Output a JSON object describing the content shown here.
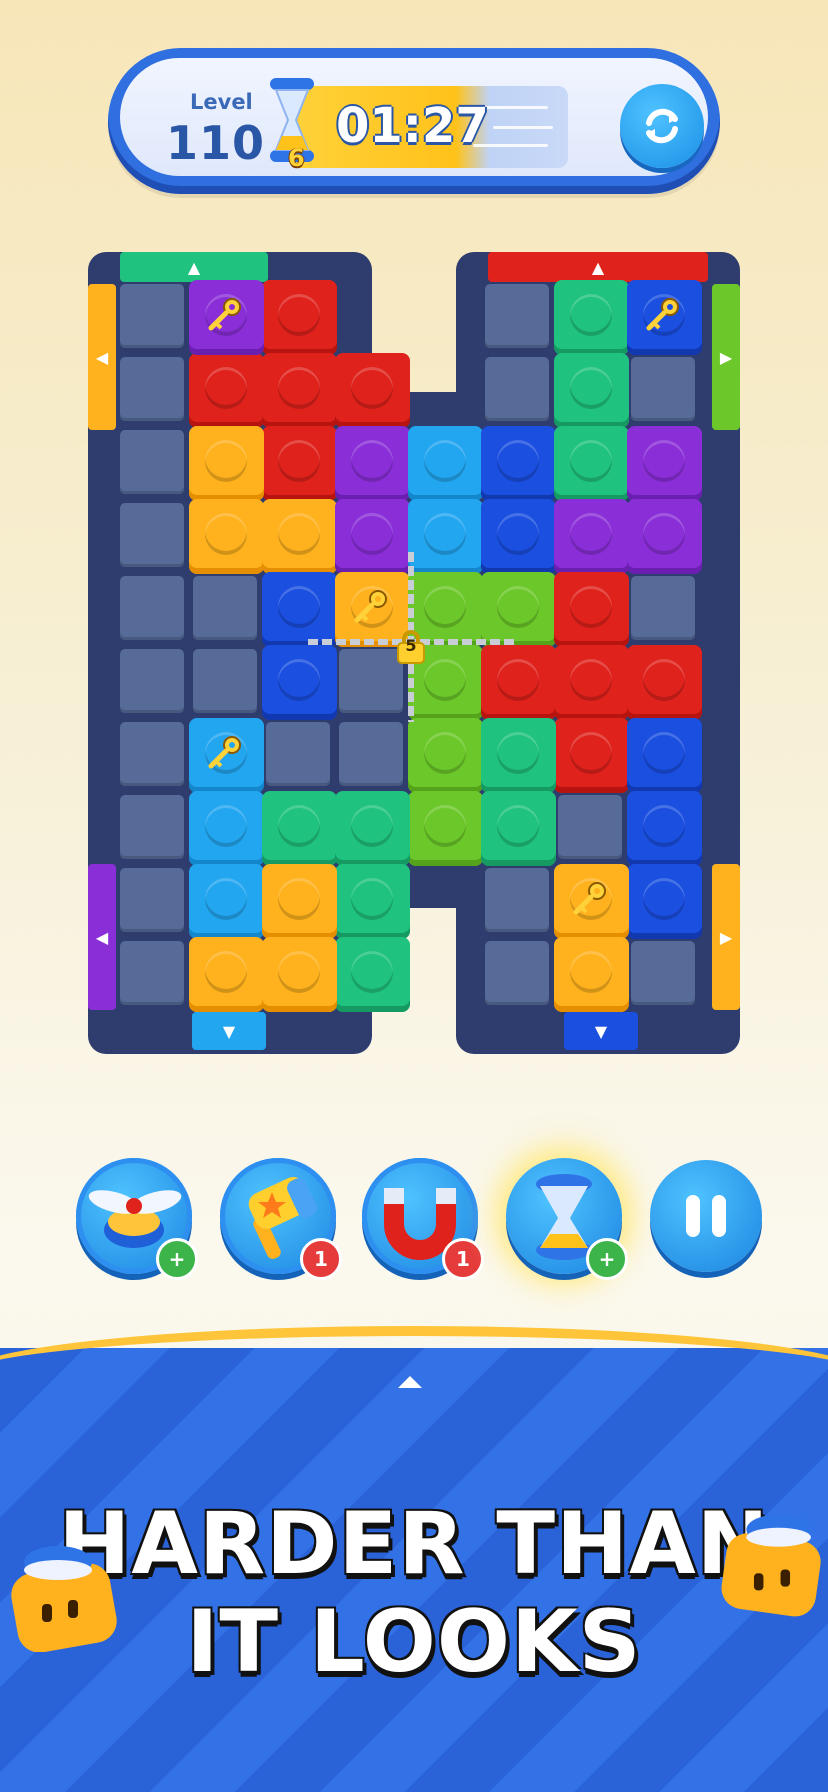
{
  "hud": {
    "level_label": "Level",
    "level_value": "110",
    "timer_value": "01:27",
    "hourglass_count": "6",
    "refresh_icon": "refresh-icon"
  },
  "boosters": [
    {
      "name": "propeller",
      "icon": "propeller-icon",
      "badge": "+"
    },
    {
      "name": "hammer",
      "icon": "hammer-icon",
      "badge": "1"
    },
    {
      "name": "magnet",
      "icon": "magnet-icon",
      "badge": "1"
    },
    {
      "name": "hourglass",
      "icon": "hourglass-icon",
      "badge": "+"
    }
  ],
  "pause_icon": "pause-icon",
  "lock_count": "5",
  "headline": {
    "line1": "HARDER THAN",
    "line2": "IT LOOKS"
  },
  "colors": {
    "red": "#e0221c",
    "green": "#1fc27e",
    "orange": "#ffb21e",
    "purple": "#8a2fd8",
    "blue": "#1a4fe0",
    "cyan": "#23a6f0",
    "lime": "#6cc82a",
    "board": "#2e3c6e",
    "cell": "#566b97"
  }
}
